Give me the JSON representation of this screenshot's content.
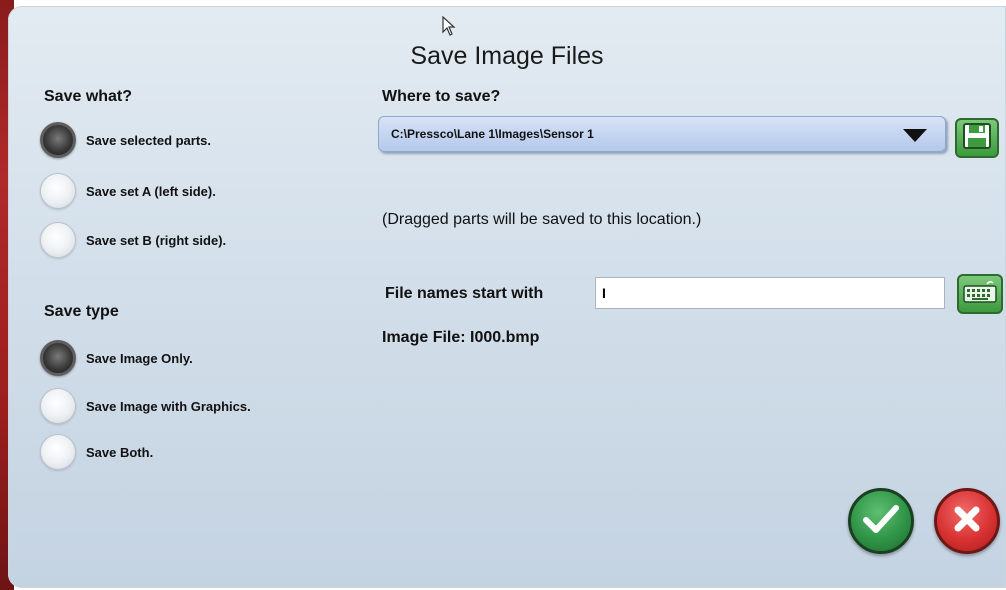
{
  "dialog": {
    "title": "Save Image Files"
  },
  "save_what": {
    "label": "Save what?",
    "options": [
      {
        "label": "Save selected parts.",
        "selected": true
      },
      {
        "label": "Save set A (left side).",
        "selected": false
      },
      {
        "label": "Save set B (right side).",
        "selected": false
      }
    ]
  },
  "save_type": {
    "label": "Save type",
    "options": [
      {
        "label": "Save Image Only.",
        "selected": true
      },
      {
        "label": "Save Image with Graphics.",
        "selected": false
      },
      {
        "label": "Save Both.",
        "selected": false
      }
    ]
  },
  "where": {
    "label": "Where to save?",
    "path": "C:\\Pressco\\Lane 1\\Images\\Sensor 1",
    "note": "(Dragged parts will be saved to this location.)"
  },
  "file_names": {
    "label": "File names start with",
    "value": "I"
  },
  "image_file": {
    "text": "Image File: I000.bmp"
  },
  "icons": {
    "save": "floppy-disk-icon",
    "keyboard": "keyboard-icon",
    "ok": "checkmark-icon",
    "cancel": "close-x-icon"
  },
  "colors": {
    "ok": "#2f9447",
    "cancel": "#d83232",
    "dropdown": "#b5c9ec"
  }
}
